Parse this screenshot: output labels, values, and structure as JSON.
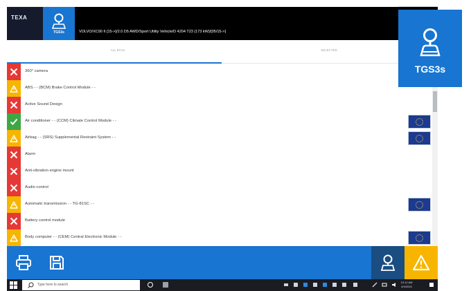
{
  "header": {
    "logo_text": "TEXA",
    "tgs_small_label": "TGS3s",
    "vehicle": "VOLVO/XC90 II [15->]/2.0 D5 AWD/Sport Utility Vehicle/D 4204 T23 (173 kW)/[05/15->]"
  },
  "tabs": [
    {
      "label": "ALL ECUs"
    },
    {
      "label": "SELECTED"
    }
  ],
  "systems": [
    {
      "label": "360° camera",
      "status": "error",
      "flag": false
    },
    {
      "label": "ABS - - (BCM) Brake Control Module - -",
      "status": "warning",
      "flag": false
    },
    {
      "label": "Active Sound Design",
      "status": "error",
      "flag": false
    },
    {
      "label": "Air conditioner - - (CCM) Climate Control Module - -",
      "status": "ok",
      "flag": true
    },
    {
      "label": "Airbag - - (SRS) Supplemental Restraint System - -",
      "status": "warning",
      "flag": true
    },
    {
      "label": "Alarm",
      "status": "error",
      "flag": false
    },
    {
      "label": "Anti-vibration engine mount",
      "status": "error",
      "flag": false
    },
    {
      "label": "Audio control",
      "status": "error",
      "flag": false
    },
    {
      "label": "Automatic transmission - - TG-81SC - -",
      "status": "warning",
      "flag": true
    },
    {
      "label": "Battery control module",
      "status": "error",
      "flag": false
    },
    {
      "label": "Body computer - - (CEM) Central Electronic Module - -",
      "status": "warning",
      "flag": true
    }
  ],
  "taskbar": {
    "search_placeholder": "Type here to search",
    "time": "10:12 AM",
    "date": "4/4/2024"
  },
  "badge": {
    "label": "TGS3s"
  },
  "colors": {
    "accent": "#1875d1",
    "error": "#e53935",
    "warning": "#f7b500",
    "ok": "#3fa646",
    "header": "#000000"
  }
}
